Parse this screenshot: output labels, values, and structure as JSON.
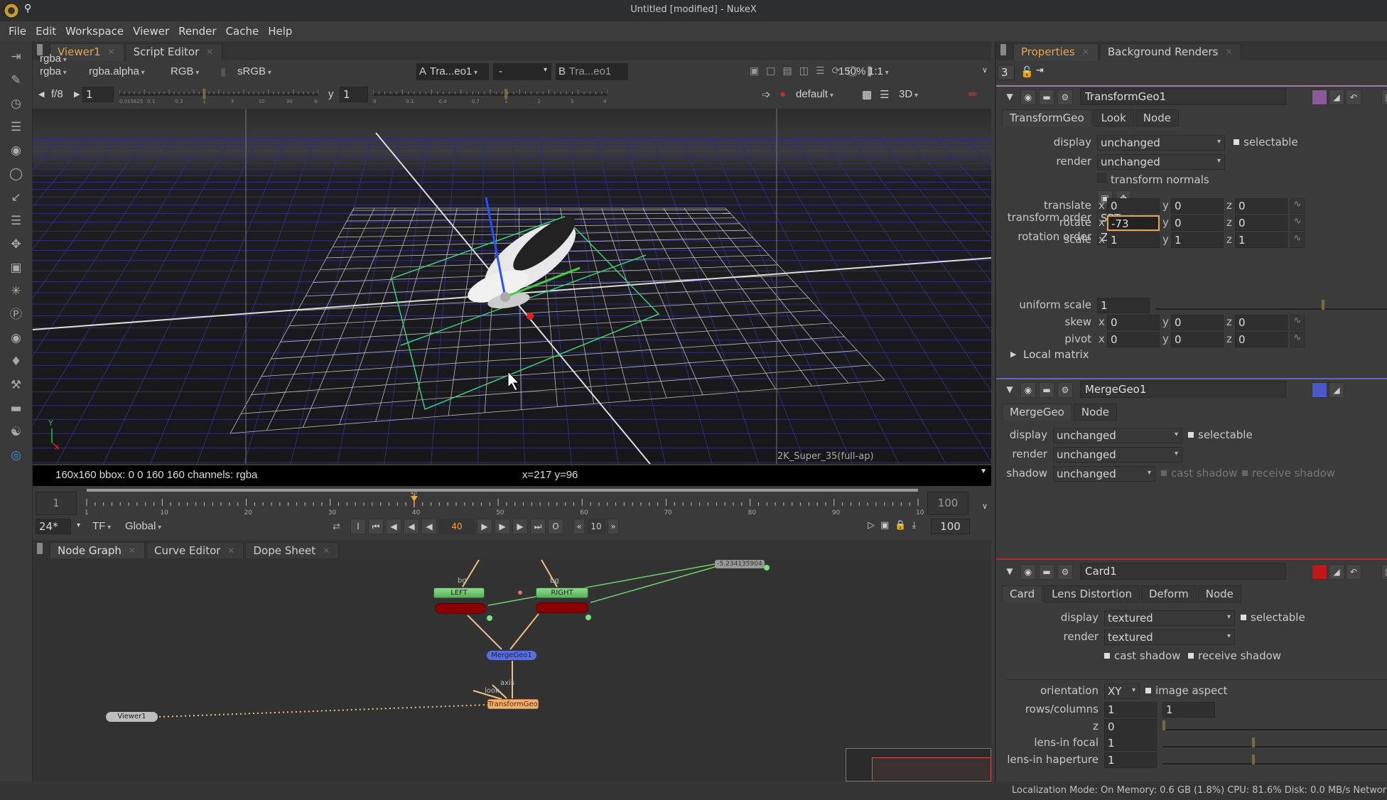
{
  "window": {
    "title": "Untitled [modified] - NukeX"
  },
  "menu": [
    "File",
    "Edit",
    "Workspace",
    "Viewer",
    "Render",
    "Cache",
    "Help"
  ],
  "left_toolbar": [
    "image-icon",
    "draw-icon",
    "time-icon",
    "channel-icon",
    "color-icon",
    "filter-icon",
    "keyer-icon",
    "merge-icon",
    "transform-icon",
    "3d-icon",
    "particles-icon",
    "deep-icon",
    "views-icon",
    "metadata-icon",
    "toolsets-icon",
    "other-icon",
    "furnace-icon",
    "ocula-icon"
  ],
  "viewer": {
    "tabs": [
      {
        "label": "Viewer1",
        "active": true
      },
      {
        "label": "Script Editor",
        "active": false
      }
    ],
    "channels": "rgba",
    "alpha": "rgba.alpha",
    "display_channels": "RGB",
    "lut": "sRGB",
    "input_a_label": "A",
    "input_a": "Tra...eo1",
    "compare": "-",
    "input_b_label": "B",
    "input_b": "Tra...eo1",
    "zoom": "150%",
    "proxy": "1:1",
    "fstop": "f/8",
    "gain": "1",
    "gamma_label": "y",
    "gamma": "1",
    "gain_ticks": [
      "0.015625",
      "0.1",
      "0.3",
      "1",
      "3",
      "10",
      "30",
      "64"
    ],
    "gamma_ticks": [
      "0",
      "0.1",
      "0.4",
      "0.7",
      "1",
      "2",
      "3",
      "4"
    ],
    "view_mode": "default",
    "view_type": "3D",
    "format_label": "2K_Super_35(full-ap)",
    "axis_y": "Y",
    "axis_x": "X",
    "info": "160x160  bbox: 0 0 160 160 channels: rgba",
    "coords": "x=217 y=96"
  },
  "timeline": {
    "start": "1",
    "end": "100",
    "current_frame": 40,
    "current_label": "40",
    "tick_labels": [
      "1",
      "10",
      "20",
      "30",
      "40",
      "50",
      "60",
      "70",
      "80",
      "90",
      "100"
    ],
    "fps": "24*",
    "tf": "TF",
    "scope": "Global",
    "frame_field": "40",
    "increment": "10",
    "end_field": "100",
    "in_label": "I",
    "out_label": "O"
  },
  "nodegraph": {
    "tabs": [
      {
        "label": "Node Graph",
        "active": true
      },
      {
        "label": "Curve Editor",
        "active": false
      },
      {
        "label": "Dope Sheet",
        "active": false
      }
    ],
    "nodes": {
      "left": "LEFT",
      "right": "RIGHT",
      "mergegeo": "MergeGeo1",
      "transformgeo": "TransformGeo1",
      "viewer": "Viewer1",
      "value": "-5.234135904"
    },
    "pipe_labels": {
      "bg1": "bg",
      "bg2": "bg",
      "axis": "axis",
      "look": "look"
    }
  },
  "properties": {
    "tabs": [
      {
        "label": "Properties",
        "active": true
      },
      {
        "label": "Background Renders",
        "active": false
      }
    ],
    "max_panels": "3",
    "transformgeo": {
      "name": "TransformGeo1",
      "tabs": [
        "TransformGeo",
        "Look",
        "Node"
      ],
      "display_label": "display",
      "display": "unchanged",
      "selectable": "selectable",
      "render_label": "render",
      "render": "unchanged",
      "transform_normals": "transform normals",
      "transform_order_label": "transform order",
      "transform_order": "SRT",
      "rotation_order_label": "rotation order",
      "rotation_order": "ZXY",
      "translate_label": "translate",
      "translate": [
        "0",
        "0",
        "0"
      ],
      "rotate_label": "rotate",
      "rotate": [
        "-73",
        "0",
        "0"
      ],
      "scale_label": "scale",
      "scale": [
        "1",
        "1",
        "1"
      ],
      "uniform_scale_label": "uniform scale",
      "uniform_scale": "1",
      "skew_label": "skew",
      "skew": [
        "0",
        "0",
        "0"
      ],
      "pivot_label": "pivot",
      "pivot": [
        "0",
        "0",
        "0"
      ],
      "local_matrix": "Local matrix"
    },
    "mergegeo": {
      "name": "MergeGeo1",
      "tabs": [
        "MergeGeo",
        "Node"
      ],
      "display_label": "display",
      "display": "unchanged",
      "selectable": "selectable",
      "render_label": "render",
      "render": "unchanged",
      "shadow_label": "shadow",
      "shadow": "unchanged",
      "cast_shadow": "cast shadow",
      "receive_shadow": "receive shadow"
    },
    "card": {
      "name": "Card1",
      "tabs": [
        "Card",
        "Lens Distortion",
        "Deform",
        "Node"
      ],
      "display_label": "display",
      "display": "textured",
      "selectable": "selectable",
      "render_label": "render",
      "render": "textured",
      "cast_shadow": "cast shadow",
      "receive_shadow": "receive shadow",
      "orientation_label": "orientation",
      "orientation": "XY",
      "image_aspect": "image aspect",
      "rows_columns_label": "rows/columns",
      "rows": "1",
      "columns": "1",
      "z_label": "z",
      "z": "0",
      "lens_in_focal_label": "lens-in focal",
      "lens_in_focal": "1",
      "lens_in_haperture_label": "lens-in haperture",
      "lens_in_haperture": "1"
    },
    "axis_labels": [
      "x",
      "y",
      "z"
    ]
  },
  "status": "Localization Mode: On  Memory: 0.6 GB (1.8%) CPU: 81.6% Disk: 0.0 MB/s Network",
  "colors": {
    "accent": "#e8a64a",
    "transformgeo_node": "#f0b070",
    "mergegeo_node": "#5a6fd8",
    "card_node": "#8a0000",
    "read_node": "#6cc56c",
    "pipe": "#f0c080",
    "link": "#70d070"
  }
}
